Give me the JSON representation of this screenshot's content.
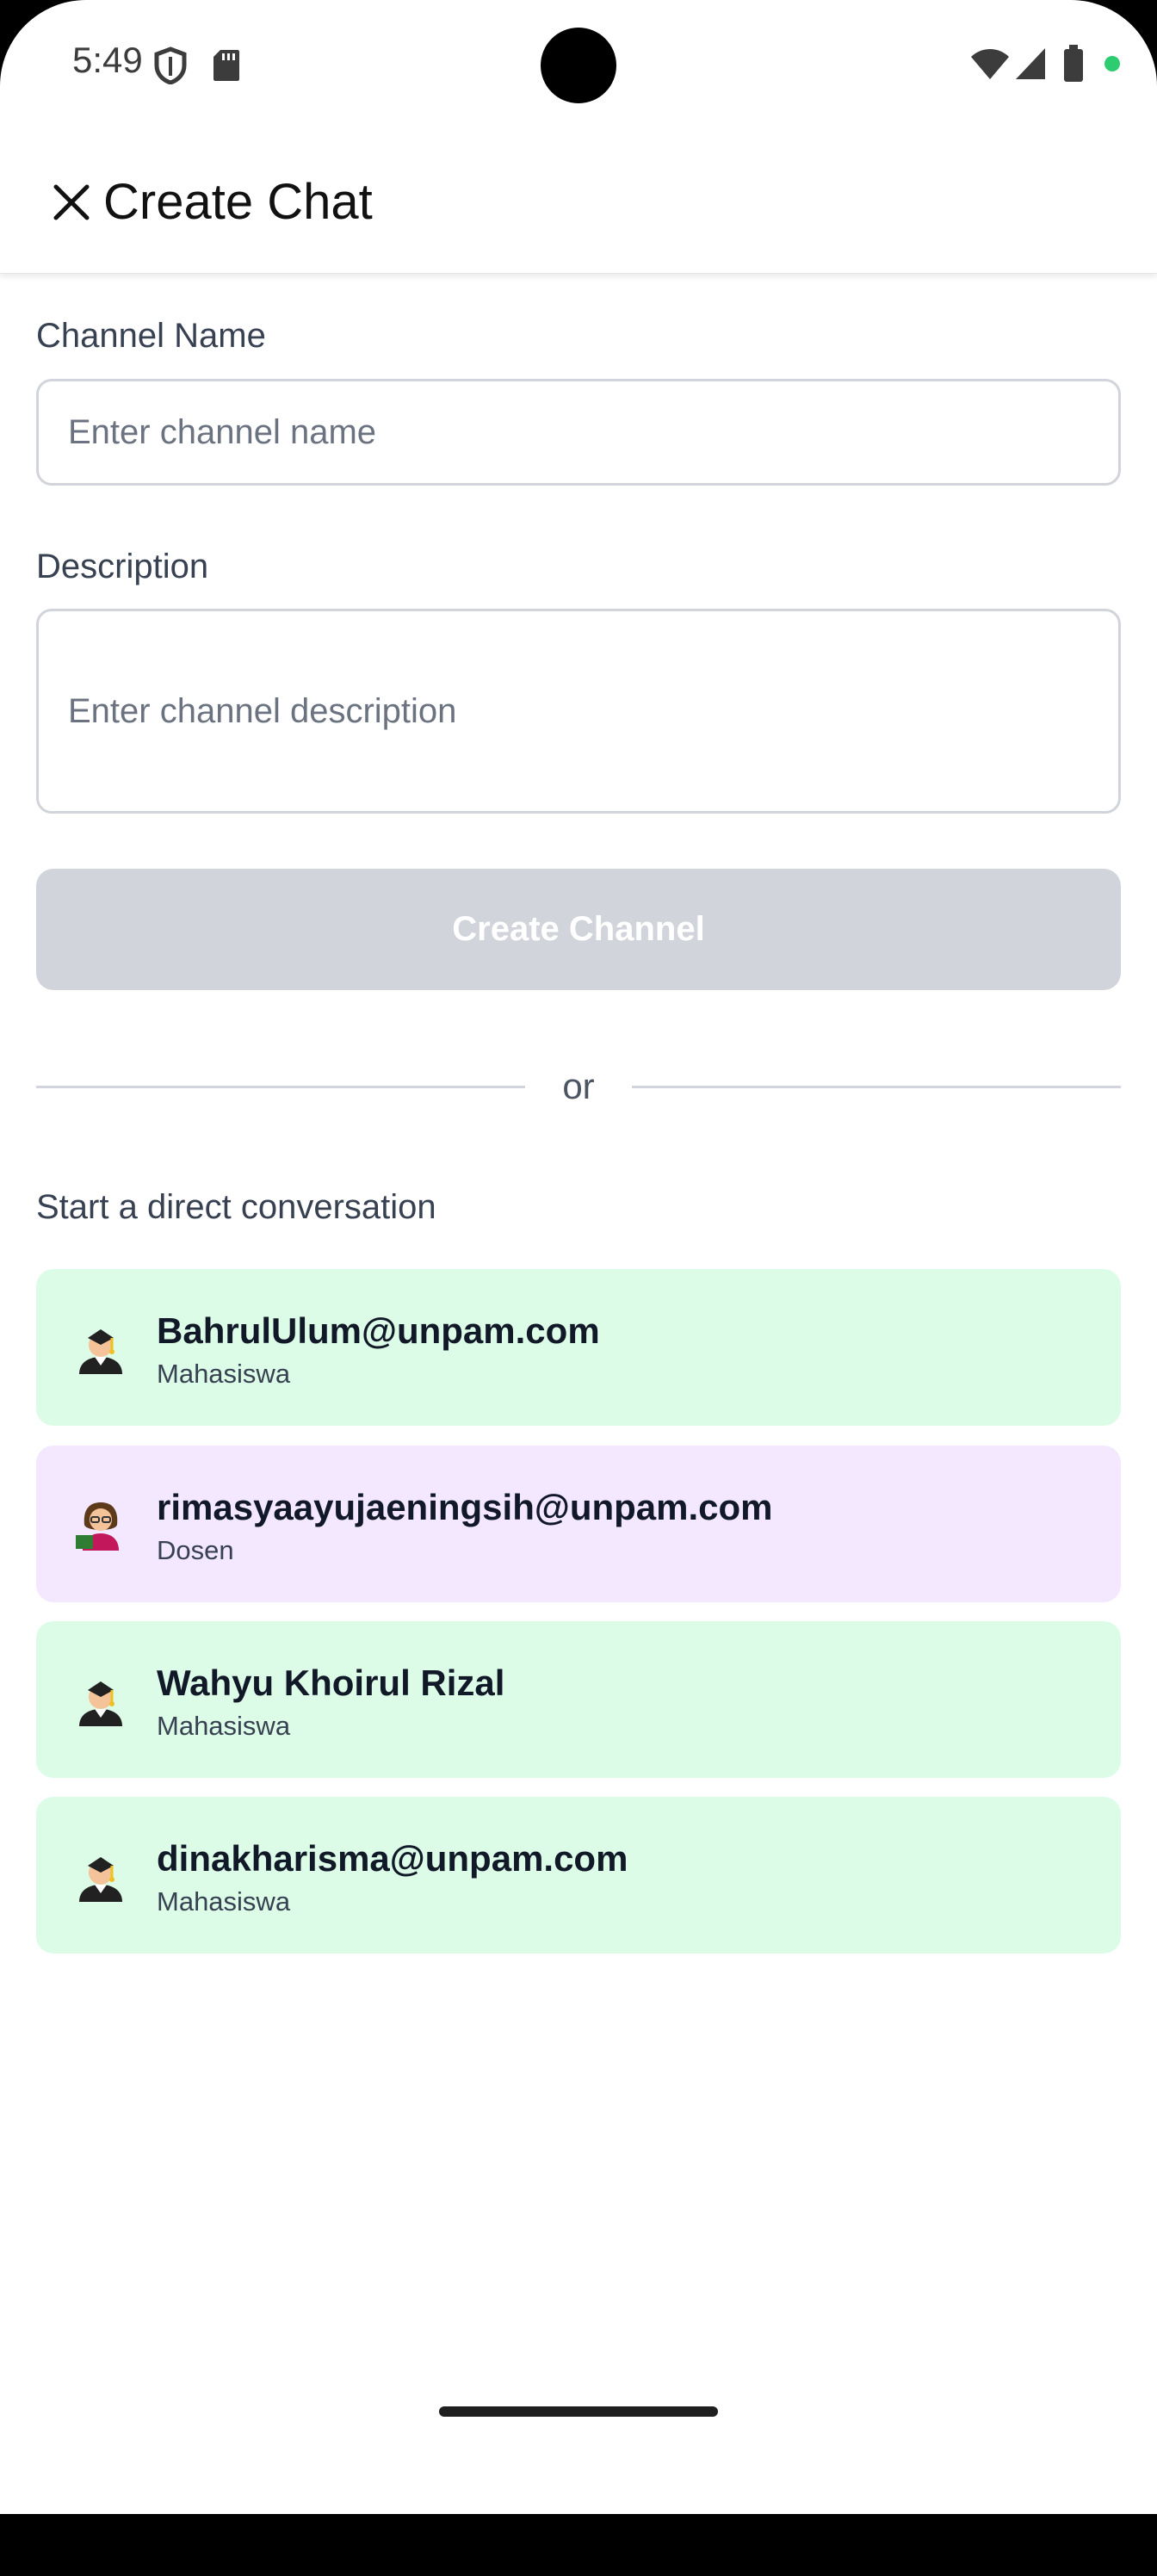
{
  "status_bar": {
    "time": "5:49",
    "icons": [
      "shield-icon",
      "sd-card-icon",
      "wifi-icon",
      "signal-icon",
      "battery-icon",
      "privacy-dot-icon"
    ]
  },
  "app_bar": {
    "close_icon": "close-icon",
    "title": "Create Chat"
  },
  "form": {
    "channel_name_label": "Channel Name",
    "channel_name_placeholder": "Enter channel name",
    "description_label": "Description",
    "description_placeholder": "Enter channel description",
    "create_button_label": "Create Channel"
  },
  "divider_text": "or",
  "direct": {
    "section_label": "Start a direct conversation",
    "users": [
      {
        "name": "BahrulUlum@unpam.com",
        "role": "Mahasiswa",
        "avatar": "student-icon"
      },
      {
        "name": "rimasyaayujaeningsih@unpam.com",
        "role": "Dosen",
        "avatar": "teacher-icon"
      },
      {
        "name": "Wahyu Khoirul Rizal",
        "role": "Mahasiswa",
        "avatar": "student-icon"
      },
      {
        "name": "dinakharisma@unpam.com",
        "role": "Mahasiswa",
        "avatar": "student-icon"
      }
    ]
  },
  "colors": {
    "student_card": "#dcfce7",
    "lecturer_card": "#f3e8ff",
    "disabled_button": "#d1d5db",
    "privacy_dot": "#2ecc71"
  }
}
